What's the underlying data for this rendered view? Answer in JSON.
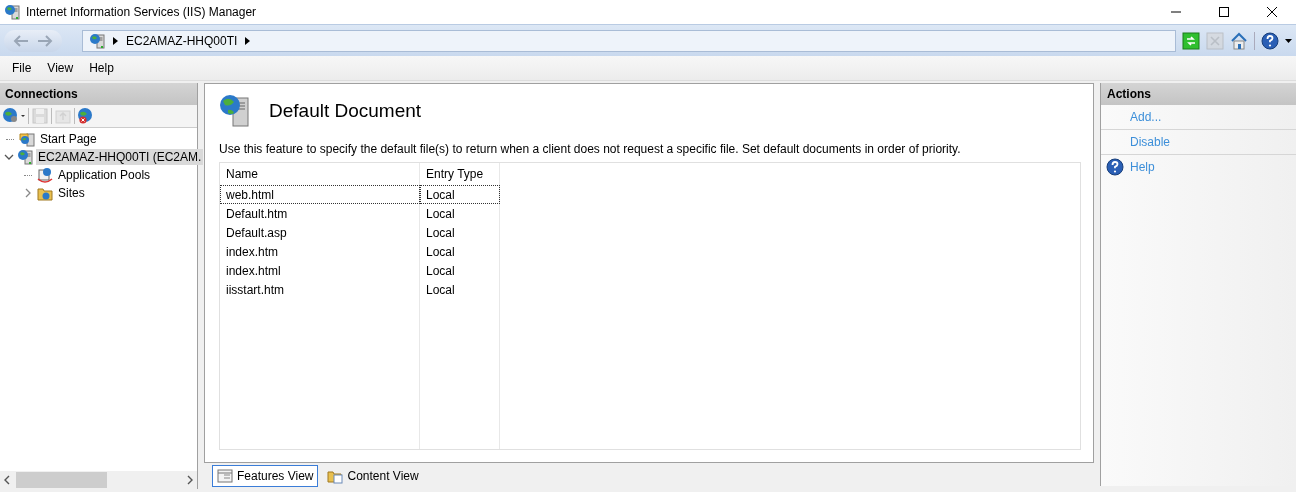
{
  "window": {
    "title": "Internet Information Services (IIS) Manager"
  },
  "address_bar": {
    "crumbs": [
      "EC2AMAZ-HHQ00TI"
    ],
    "toolbar": [
      {
        "kind": "refresh",
        "disabled": false
      },
      {
        "kind": "stop",
        "disabled": true
      },
      {
        "kind": "home",
        "disabled": false
      },
      {
        "kind": "help",
        "disabled": false
      }
    ]
  },
  "menu": [
    "File",
    "View",
    "Help"
  ],
  "connections": {
    "title": "Connections",
    "toolbar": [
      {
        "kind": "connect",
        "disabled": false
      },
      {
        "kind": "save",
        "disabled": true
      },
      {
        "kind": "up",
        "disabled": true
      },
      {
        "kind": "disconnect",
        "disabled": false
      }
    ],
    "tree": [
      {
        "label": "Start Page",
        "kind": "start",
        "selected": false
      },
      {
        "label": "EC2AMAZ-HHQ00TI (EC2AM.",
        "kind": "server",
        "selected": true,
        "expanded": true,
        "children": [
          {
            "label": "Application Pools",
            "kind": "pools",
            "selected": false
          },
          {
            "label": "Sites",
            "kind": "sites",
            "selected": false,
            "expanded": false
          }
        ]
      }
    ]
  },
  "content": {
    "title": "Default Document",
    "description": "Use this feature to specify the default file(s) to return when a client does not request a specific file. Set default documents in order of priority.",
    "table": {
      "columns": [
        "Name",
        "Entry Type"
      ],
      "rows": [
        {
          "cells": [
            "web.html",
            "Local"
          ],
          "selected": true
        },
        {
          "cells": [
            "Default.htm",
            "Local"
          ],
          "selected": false
        },
        {
          "cells": [
            "Default.asp",
            "Local"
          ],
          "selected": false
        },
        {
          "cells": [
            "index.htm",
            "Local"
          ],
          "selected": false
        },
        {
          "cells": [
            "index.html",
            "Local"
          ],
          "selected": false
        },
        {
          "cells": [
            "iisstart.htm",
            "Local"
          ],
          "selected": false
        }
      ]
    },
    "view_tabs": [
      {
        "label": "Features View",
        "kind": "features",
        "selected": true
      },
      {
        "label": "Content View",
        "kind": "content",
        "selected": false
      }
    ]
  },
  "actions": {
    "title": "Actions",
    "items": [
      {
        "label": "Add...",
        "kind": "link"
      },
      {
        "label": "Disable",
        "kind": "link"
      },
      {
        "label": "Help",
        "kind": "help"
      }
    ]
  }
}
